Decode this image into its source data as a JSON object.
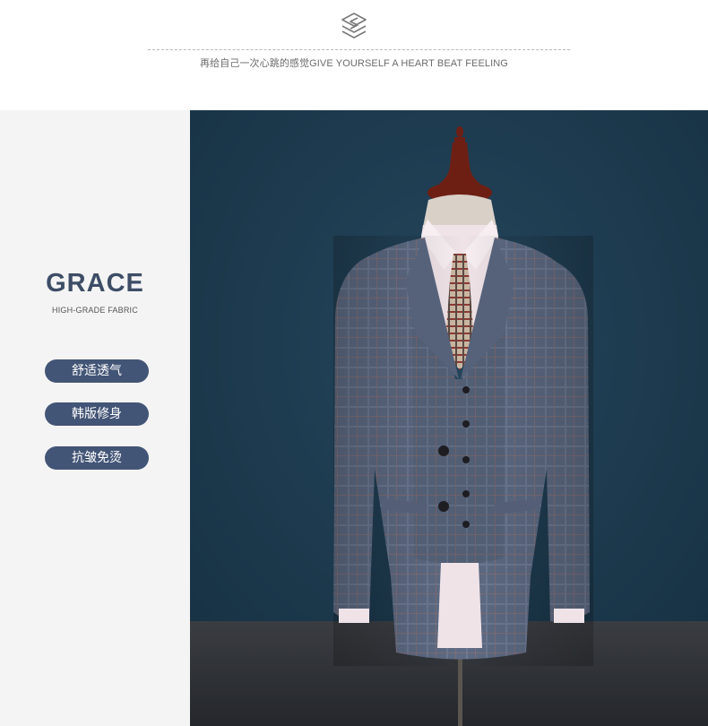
{
  "header": {
    "logo_icon": "stacked-s-logo-icon",
    "tagline": "再给自己一次心跳的感觉GIVE YOURSELF A HEART BEAT FEELING"
  },
  "feature": {
    "title": "GRACE",
    "subtitle": "HIGH-GRADE FABRIC",
    "tags": [
      "舒适透气",
      "韩版修身",
      "抗皱免烫"
    ]
  },
  "colors": {
    "accent": "#435576",
    "title_color": "#3d4d66",
    "panel_bg": "#f4f4f4",
    "photo_backdrop": "#1f3a4f"
  }
}
